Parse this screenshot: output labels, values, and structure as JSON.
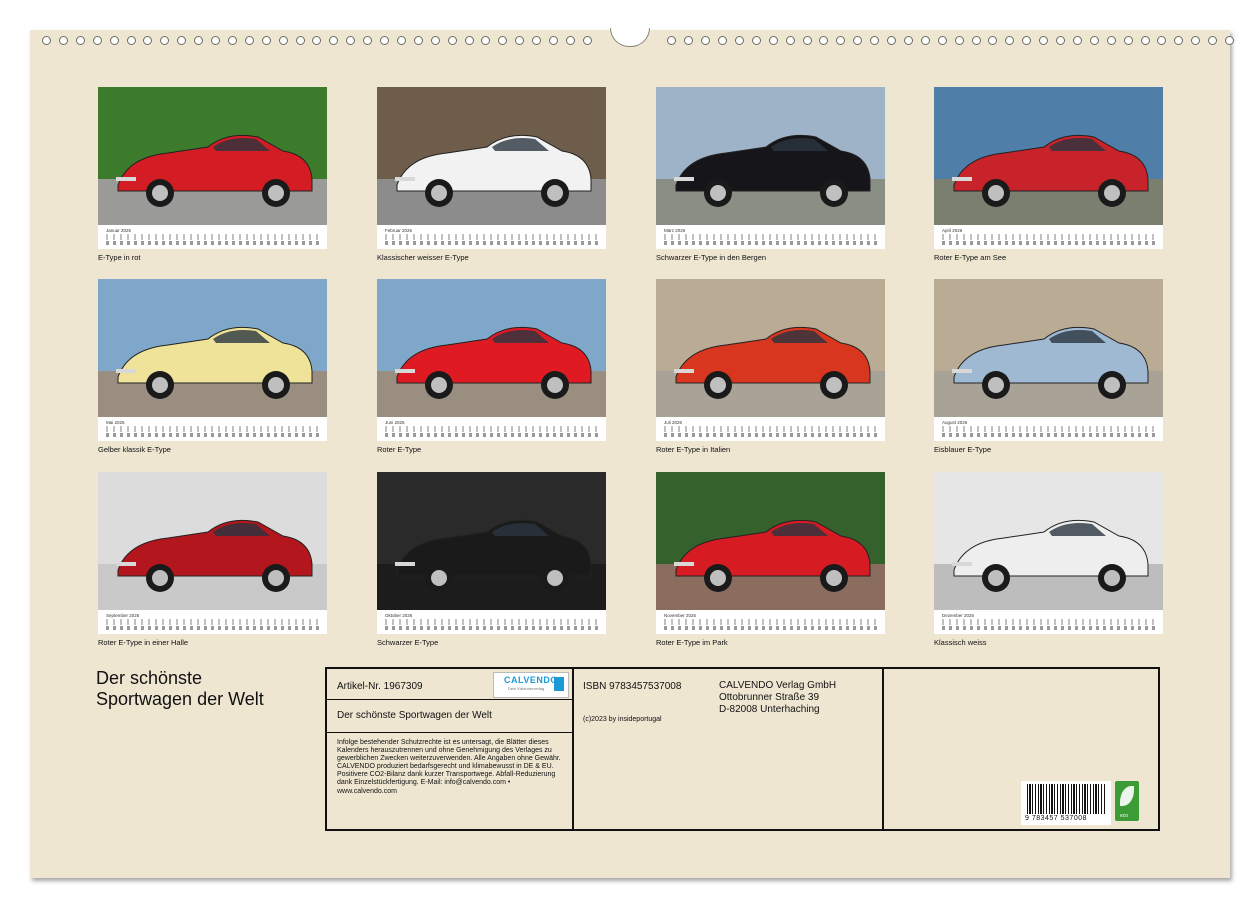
{
  "months": [
    {
      "label": "Januar 2026",
      "caption": "E-Type in rot",
      "car_color": "#d41c24",
      "scene": "hedge"
    },
    {
      "label": "Februar 2026",
      "caption": "Klassischer weisser E-Type",
      "car_color": "#f2f2f2",
      "scene": "building"
    },
    {
      "label": "März 2026",
      "caption": "Schwarzer E-Type in den Bergen",
      "car_color": "#15151a",
      "scene": "mountains"
    },
    {
      "label": "April 2026",
      "caption": "Roter E-Type am See",
      "car_color": "#c8222a",
      "scene": "lake"
    },
    {
      "label": "Mai 2026",
      "caption": "Gelber klassik E-Type",
      "car_color": "#efe39a",
      "scene": "street"
    },
    {
      "label": "Juni 2026",
      "caption": "Roter E-Type",
      "car_color": "#e01a22",
      "scene": "street"
    },
    {
      "label": "Juli 2026",
      "caption": "Roter E-Type in Italien",
      "car_color": "#d8361e",
      "scene": "wall"
    },
    {
      "label": "August 2026",
      "caption": "Eisblauer E-Type",
      "car_color": "#9fb9d2",
      "scene": "wall"
    },
    {
      "label": "September 2026",
      "caption": "Roter E-Type in einer Halle",
      "car_color": "#b3161c",
      "scene": "hall"
    },
    {
      "label": "Oktober 2026",
      "caption": "Schwarzer E-Type",
      "car_color": "#1a1a1a",
      "scene": "dark"
    },
    {
      "label": "November 2026",
      "caption": "Roter E-Type im Park",
      "car_color": "#d61b22",
      "scene": "park"
    },
    {
      "label": "Dezember 2026",
      "caption": "Klassisch weiss",
      "car_color": "#eeeeee",
      "scene": "garage"
    }
  ],
  "title_lines": [
    "Der schönste",
    "Sportwagen der Welt"
  ],
  "info": {
    "article": "Artikel-Nr. 1967309",
    "logo_name": "CALVENDO",
    "logo_sub": "Dein Kalenderverlag",
    "subtitle": "Der schönste Sportwagen der Welt",
    "isbn": "ISBN 9783457537008",
    "copyright": "(c)2023 by insideportugal",
    "publisher": [
      "CALVENDO Verlag GmbH",
      "Ottobrunner Straße 39",
      "D-82008 Unterhaching"
    ],
    "legal": "Infolge bestehender Schutzrechte ist es untersagt, die Blätter dieses Kalenders herauszutrennen und ohne Genehmigung des Verlages zu gewerblichen Zwecken weiterzuverwenden. Alle Angaben ohne Gewähr. CALVENDO produziert bedarfsgerecht und klimabewusst in DE & EU. Positivere CO2-Bilanz dank kurzer Transportwege. Abfall-Reduzierung dank Einzelstückfertigung. E-Mail: info@calvendo.com • www.calvendo.com",
    "barcode_digits": "9 783457 537008",
    "eco_label": "eco"
  }
}
